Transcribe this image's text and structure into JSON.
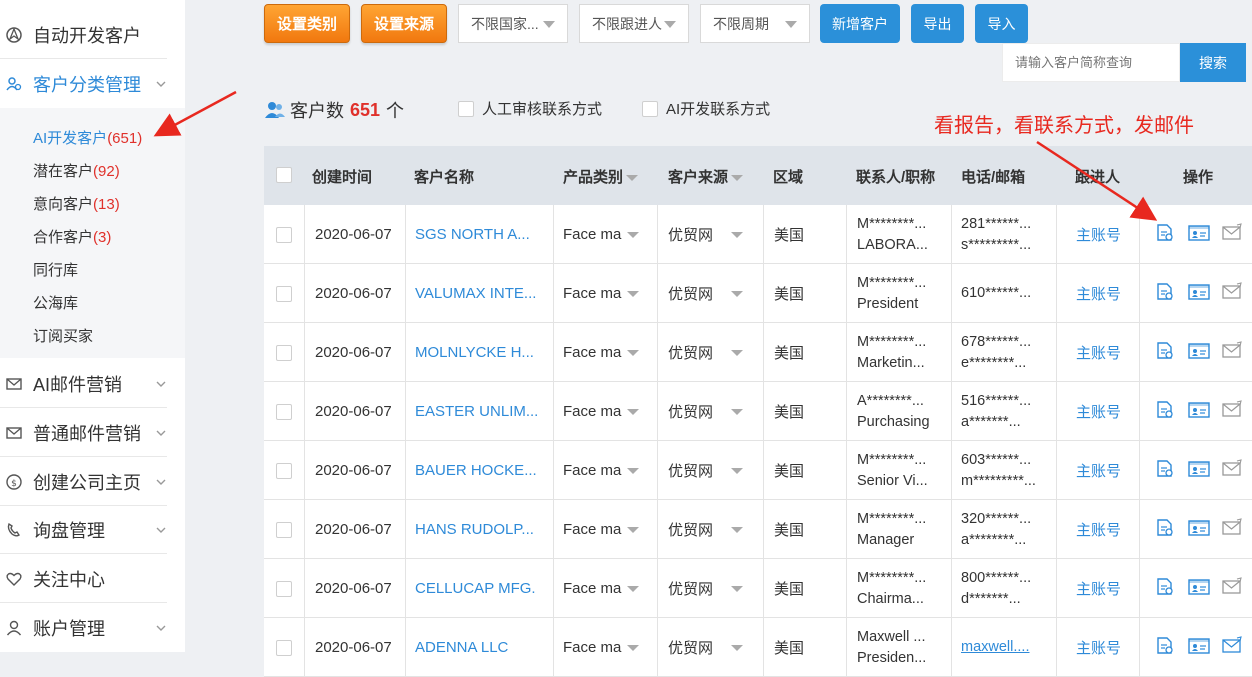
{
  "sidebar": {
    "top_item": "自动开发客户",
    "active_group": "客户分类管理",
    "sub_items": [
      {
        "label": "AI开发客户",
        "count": "(651)",
        "active": true
      },
      {
        "label": "潜在客户",
        "count": "(92)"
      },
      {
        "label": "意向客户",
        "count": "(13)"
      },
      {
        "label": "合作客户",
        "count": "(3)"
      },
      {
        "label": "同行库",
        "count": ""
      },
      {
        "label": "公海库",
        "count": ""
      },
      {
        "label": "订阅买家",
        "count": ""
      }
    ],
    "groups": [
      {
        "label": "AI邮件营销",
        "icon": "mail-ai-icon"
      },
      {
        "label": "普通邮件营销",
        "icon": "mail-icon"
      },
      {
        "label": "创建公司主页",
        "icon": "home-page-icon"
      },
      {
        "label": "询盘管理",
        "icon": "phone-icon"
      },
      {
        "label": "关注中心",
        "icon": "heart-icon"
      },
      {
        "label": "账户管理",
        "icon": "user-icon"
      }
    ]
  },
  "toolbar": {
    "set_category": "设置类别",
    "set_source": "设置来源",
    "filter_country": "不限国家...",
    "filter_follower": "不限跟进人",
    "filter_period": "不限周期",
    "add_customer": "新增客户",
    "export": "导出",
    "import": "导入",
    "search_placeholder": "请输入客户简称查询",
    "search_button": "搜索"
  },
  "summary": {
    "count_prefix": "客户数",
    "count": "651",
    "count_suffix": "个",
    "manual_review": "人工审核联系方式",
    "ai_contact": "AI开发联系方式"
  },
  "annotation": "看报告，看联系方式，发邮件",
  "table": {
    "headers": {
      "created": "创建时间",
      "name": "客户名称",
      "category": "产品类别",
      "source": "客户来源",
      "region": "区域",
      "contact": "联系人/职称",
      "phone": "电话/邮箱",
      "follower": "跟进人",
      "actions": "操作"
    },
    "rows": [
      {
        "date": "2020-06-07",
        "name": "SGS NORTH A...",
        "category": "Face ma",
        "source": "优贸网",
        "region": "美国",
        "contact1": "M********...",
        "contact2": "LABORA...",
        "phone1": "281******...",
        "phone2": "s*********...",
        "follower": "主账号"
      },
      {
        "date": "2020-06-07",
        "name": "VALUMAX INTE...",
        "category": "Face ma",
        "source": "优贸网",
        "region": "美国",
        "contact1": "M********...",
        "contact2": "President",
        "phone1": "610******...",
        "phone2": "",
        "follower": "主账号"
      },
      {
        "date": "2020-06-07",
        "name": "MOLNLYCKE H...",
        "category": "Face ma",
        "source": "优贸网",
        "region": "美国",
        "contact1": "M********...",
        "contact2": "Marketin...",
        "phone1": "678******...",
        "phone2": "e********...",
        "follower": "主账号"
      },
      {
        "date": "2020-06-07",
        "name": "EASTER UNLIM...",
        "category": "Face ma",
        "source": "优贸网",
        "region": "美国",
        "contact1": "A********...",
        "contact2": "Purchasing",
        "phone1": "516******...",
        "phone2": "a*******...",
        "follower": "主账号"
      },
      {
        "date": "2020-06-07",
        "name": "BAUER HOCKE...",
        "category": "Face ma",
        "source": "优贸网",
        "region": "美国",
        "contact1": "M********...",
        "contact2": "Senior Vi...",
        "phone1": "603******...",
        "phone2": "m*********...",
        "follower": "主账号"
      },
      {
        "date": "2020-06-07",
        "name": "HANS RUDOLP...",
        "category": "Face ma",
        "source": "优贸网",
        "region": "美国",
        "contact1": "M********...",
        "contact2": "Manager",
        "phone1": "320******...",
        "phone2": "a********...",
        "follower": "主账号"
      },
      {
        "date": "2020-06-07",
        "name": "CELLUCAP MFG.",
        "category": "Face ma",
        "source": "优贸网",
        "region": "美国",
        "contact1": "M********...",
        "contact2": "Chairma...",
        "phone1": "800******...",
        "phone2": "d*******...",
        "follower": "主账号"
      },
      {
        "date": "2020-06-07",
        "name": "ADENNA LLC",
        "category": "Face ma",
        "source": "优贸网",
        "region": "美国",
        "contact1": "Maxwell ...",
        "contact2": "Presiden...",
        "phone1": "",
        "phone2": "maxwell....",
        "phone2_link": true,
        "follower": "主账号"
      }
    ]
  },
  "colors": {
    "accent_blue": "#2b90d9",
    "orange": "#f1780f",
    "red": "#e0312b",
    "header_bg": "#dfe4ea"
  }
}
